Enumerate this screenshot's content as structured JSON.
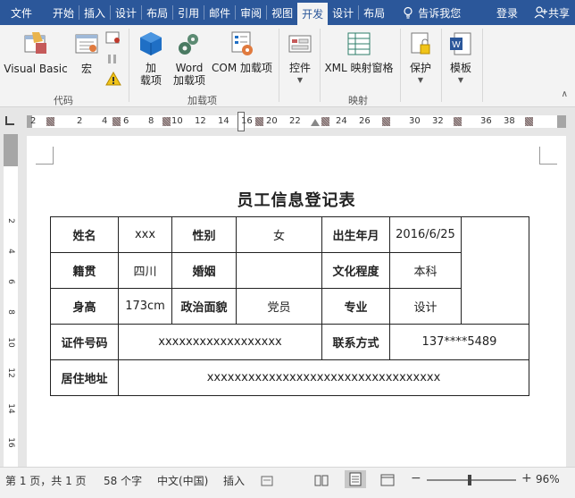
{
  "tabs": [
    "文件",
    "开始",
    "插入",
    "设计",
    "布局",
    "引用",
    "邮件",
    "审阅",
    "视图",
    "开发",
    "设计",
    "布局"
  ],
  "active_tab_index": 9,
  "tell_me": "告诉我您",
  "login": "登录",
  "share": "共享",
  "ribbon": {
    "groups": [
      {
        "label": "代码",
        "buttons": [
          "Visual Basic",
          "宏"
        ]
      },
      {
        "label": "加载项",
        "buttons": [
          "加\n载项",
          "Word\n加载项",
          "COM 加载项"
        ]
      },
      {
        "label": "",
        "buttons": [
          "控件"
        ]
      },
      {
        "label": "映射",
        "buttons": [
          "XML 映射窗格"
        ]
      },
      {
        "label": "",
        "buttons": [
          "保护",
          "模板"
        ]
      }
    ]
  },
  "ruler": {
    "numbers": [
      "2",
      "2",
      "4",
      "6",
      "8",
      "10",
      "12",
      "14",
      "16",
      "20",
      "22",
      "24",
      "26",
      "30",
      "32",
      "36",
      "38"
    ]
  },
  "vruler": {
    "numbers": [
      "2",
      "4",
      "6",
      "8",
      "10",
      "12",
      "14",
      "16"
    ]
  },
  "document": {
    "title": "员工信息登记表",
    "rows": [
      [
        "姓名",
        "xxx",
        "性别",
        "女",
        "出生年月",
        "2016/6/25"
      ],
      [
        "籍贯",
        "四川",
        "婚姻",
        "",
        "文化程度",
        "本科"
      ],
      [
        "身高",
        "173cm",
        "政治面貌",
        "党员",
        "专业",
        "设计"
      ],
      [
        "证件号码",
        "xxxxxxxxxxxxxxxxxx",
        "联系方式",
        "137****5489"
      ],
      [
        "居住地址",
        "xxxxxxxxxxxxxxxxxxxxxxxxxxxxxxxxxx"
      ]
    ]
  },
  "status": {
    "page": "第 1 页，共 1 页",
    "words": "58 个字",
    "language": "中文(中国)",
    "mode": "插入",
    "zoom": "96%",
    "zoom_level": 0.96
  },
  "colors": {
    "title_bar": "#2b579a",
    "ribbon_bg": "#f3f3f3",
    "page_bg": "#ffffff"
  }
}
